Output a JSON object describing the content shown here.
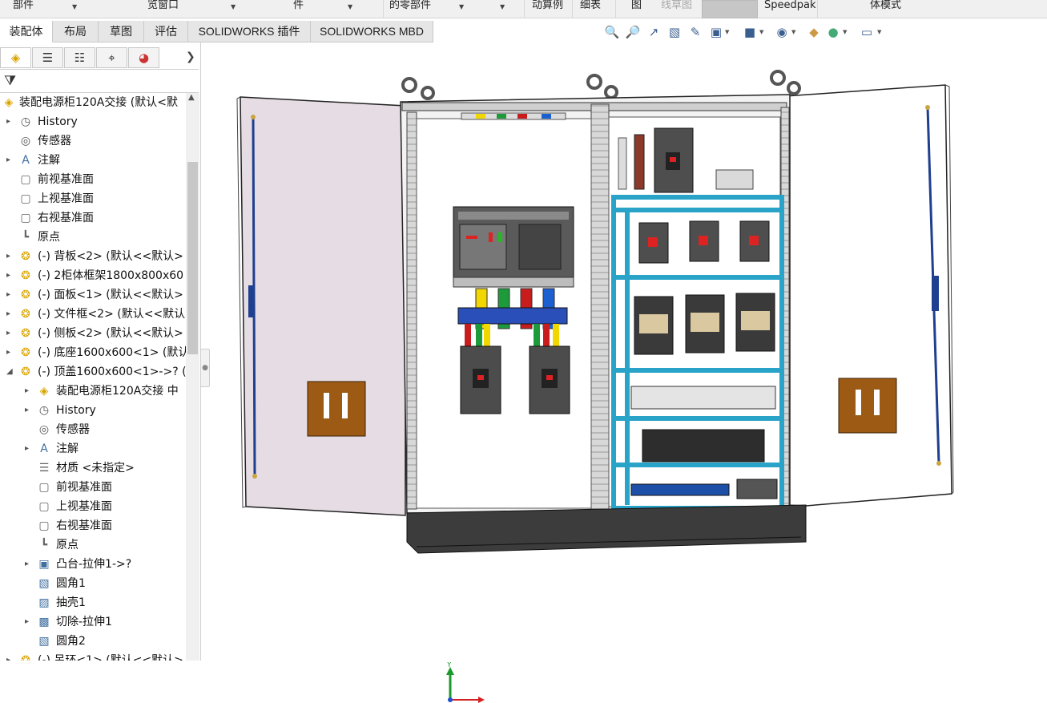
{
  "ribbon": {
    "items": [
      {
        "label": "部件",
        "dim": true
      },
      {
        "label": "览窗口",
        "dim": true
      },
      {
        "label": "件",
        "dim": false
      },
      {
        "label": "的零部件",
        "dim": false
      },
      {
        "label": "动算例",
        "dim": false
      },
      {
        "label": "细表",
        "dim": false
      },
      {
        "label": "图",
        "dim": false
      },
      {
        "label": "线草图",
        "dim": true
      },
      {
        "label": "Speedpak",
        "dim": false
      },
      {
        "label": "体模式",
        "dim": false
      }
    ]
  },
  "command_tabs": [
    "装配体",
    "布局",
    "草图",
    "评估",
    "SOLIDWORKS 插件",
    "SOLIDWORKS MBD"
  ],
  "active_tab": "装配体",
  "view_toolbar": {
    "icons": [
      "zoom-to-fit-icon",
      "zoom-to-area-icon",
      "previous-view-icon",
      "section-view-icon",
      "dynamic-annotation-icon",
      "view-orientation-icon",
      "display-style-icon",
      "hide-show-icon",
      "edit-appearance-icon",
      "apply-scene-icon",
      "view-settings-icon"
    ]
  },
  "feature_manager": {
    "tabs": [
      "featuremanager-tab",
      "propertymanager-tab",
      "configurationmanager-tab",
      "dimxpert-tab",
      "displaymanager-tab"
    ],
    "tree": [
      {
        "label": "装配电源柜120A交接 (默认<默",
        "icon": "assembly-icon",
        "level": 0,
        "expand": "none"
      },
      {
        "label": "History",
        "icon": "history-icon",
        "level": 1,
        "expand": "collapsed"
      },
      {
        "label": "传感器",
        "icon": "sensor-icon",
        "level": 1,
        "expand": "none"
      },
      {
        "label": "注解",
        "icon": "annotation-icon",
        "level": 1,
        "expand": "collapsed"
      },
      {
        "label": "前视基准面",
        "icon": "plane-icon",
        "level": 1,
        "expand": "none"
      },
      {
        "label": "上视基准面",
        "icon": "plane-icon",
        "level": 1,
        "expand": "none"
      },
      {
        "label": "右视基准面",
        "icon": "plane-icon",
        "level": 1,
        "expand": "none"
      },
      {
        "label": "原点",
        "icon": "origin-icon",
        "level": 1,
        "expand": "none"
      },
      {
        "label": "(-) 背板<2> (默认<<默认>",
        "icon": "part-icon",
        "level": 1,
        "expand": "collapsed"
      },
      {
        "label": "(-) 2柜体框架1800x800x60",
        "icon": "part-icon",
        "level": 1,
        "expand": "collapsed"
      },
      {
        "label": "(-) 面板<1> (默认<<默认>",
        "icon": "part-icon",
        "level": 1,
        "expand": "collapsed"
      },
      {
        "label": "(-) 文件框<2> (默认<<默认",
        "icon": "part-icon",
        "level": 1,
        "expand": "collapsed"
      },
      {
        "label": "(-) 侧板<2> (默认<<默认>",
        "icon": "part-icon",
        "level": 1,
        "expand": "collapsed"
      },
      {
        "label": "(-) 底座1600x600<1> (默认",
        "icon": "part-icon",
        "level": 1,
        "expand": "collapsed"
      },
      {
        "label": "(-) 顶盖1600x600<1>->? (",
        "icon": "part-icon",
        "level": 1,
        "expand": "expanded"
      },
      {
        "label": "装配电源柜120A交接 中",
        "icon": "assembly-icon",
        "level": 2,
        "expand": "collapsed"
      },
      {
        "label": "History",
        "icon": "history-icon",
        "level": 2,
        "expand": "collapsed"
      },
      {
        "label": "传感器",
        "icon": "sensor-icon",
        "level": 2,
        "expand": "none"
      },
      {
        "label": "注解",
        "icon": "annotation-icon",
        "level": 2,
        "expand": "collapsed"
      },
      {
        "label": "材质 <未指定>",
        "icon": "material-icon",
        "level": 2,
        "expand": "none"
      },
      {
        "label": "前视基准面",
        "icon": "plane-icon",
        "level": 2,
        "expand": "none"
      },
      {
        "label": "上视基准面",
        "icon": "plane-icon",
        "level": 2,
        "expand": "none"
      },
      {
        "label": "右视基准面",
        "icon": "plane-icon",
        "level": 2,
        "expand": "none"
      },
      {
        "label": "原点",
        "icon": "origin-icon",
        "level": 2,
        "expand": "none"
      },
      {
        "label": "凸台-拉伸1->?",
        "icon": "extrude-icon",
        "level": 2,
        "expand": "collapsed"
      },
      {
        "label": "圆角1",
        "icon": "fillet-icon",
        "level": 2,
        "expand": "none"
      },
      {
        "label": "抽壳1",
        "icon": "shell-icon",
        "level": 2,
        "expand": "none"
      },
      {
        "label": "切除-拉伸1",
        "icon": "cut-extrude-icon",
        "level": 2,
        "expand": "collapsed"
      },
      {
        "label": "圆角2",
        "icon": "fillet-icon",
        "level": 2,
        "expand": "none"
      },
      {
        "label": "(-) 吊环<1> (默认<<默认>",
        "icon": "part-icon",
        "level": 1,
        "expand": "collapsed"
      }
    ]
  },
  "triad": {
    "axis_y": "Y"
  }
}
